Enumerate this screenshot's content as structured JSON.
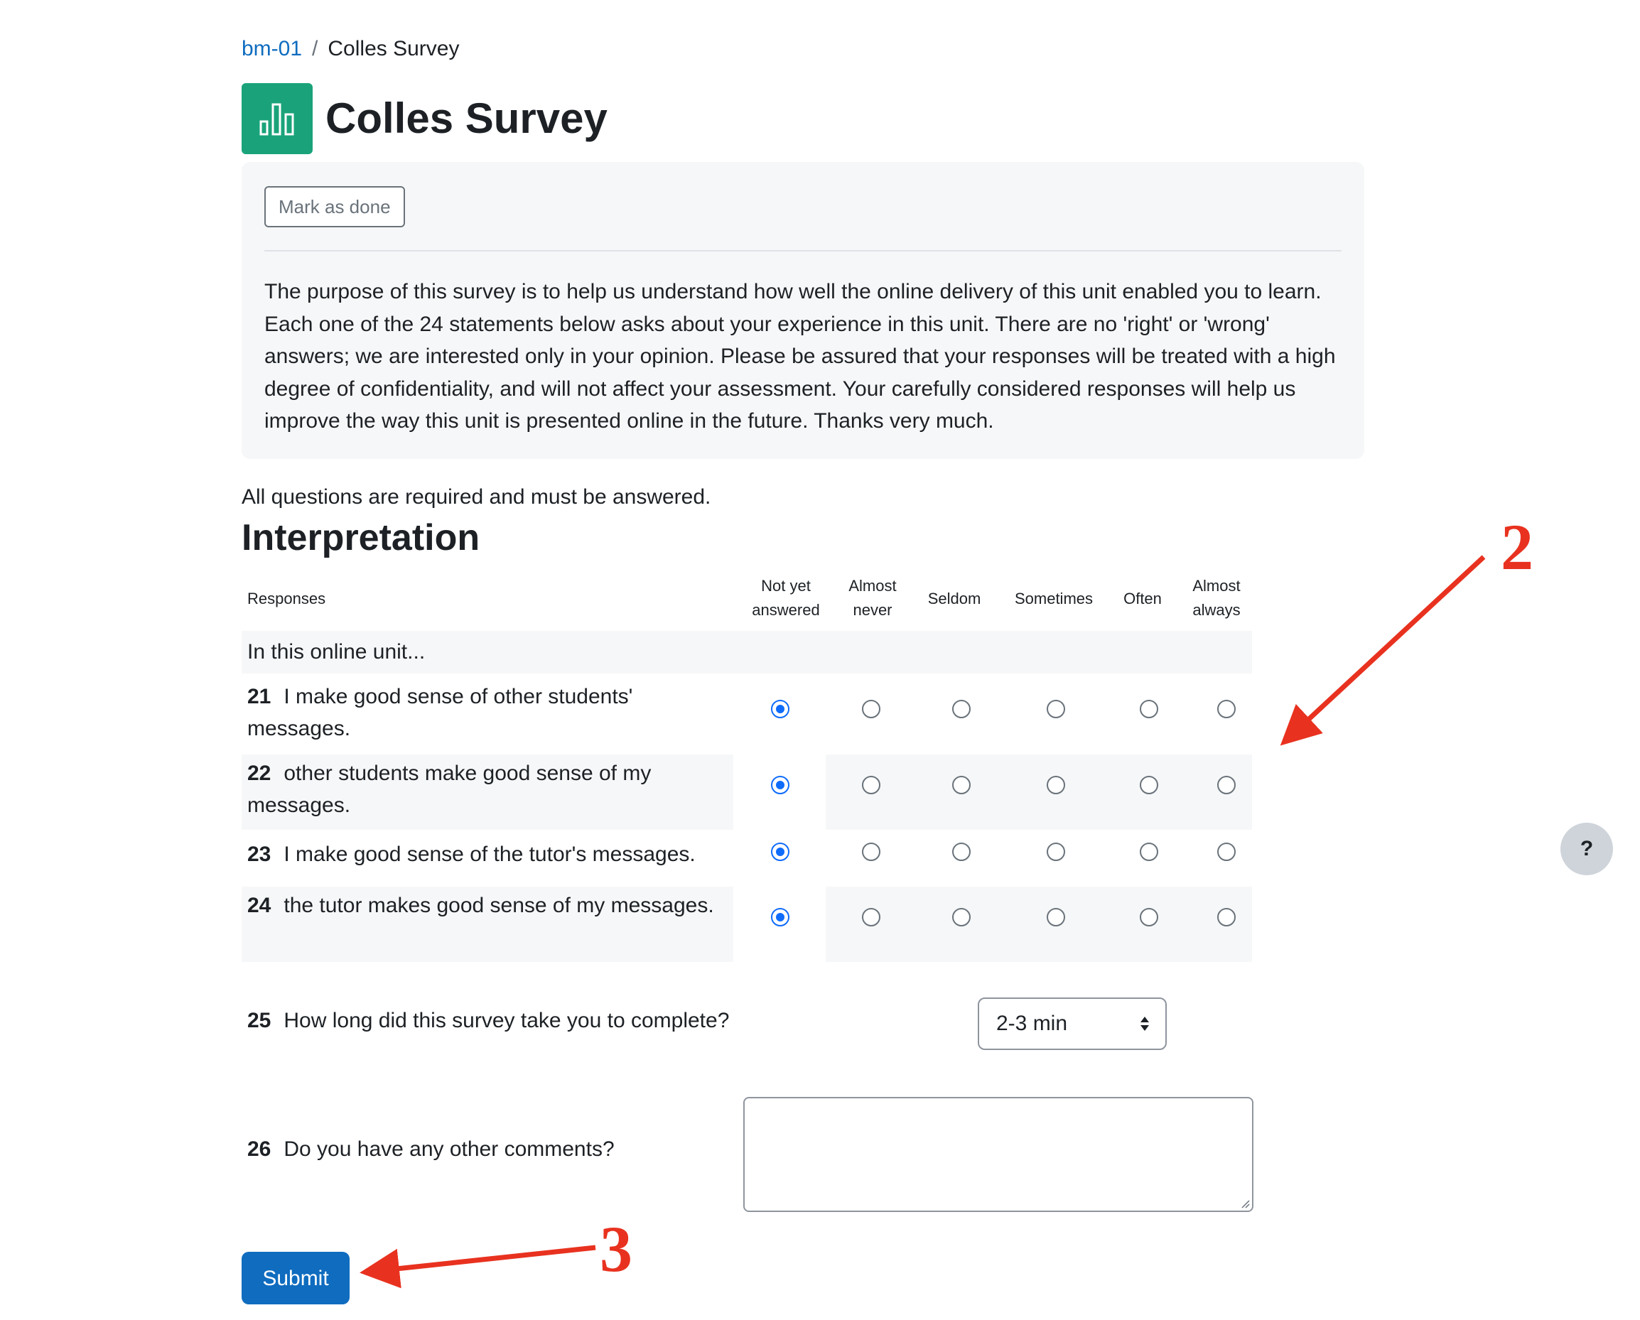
{
  "breadcrumb": {
    "course": "bm-01",
    "separator": "/",
    "current": "Colles Survey"
  },
  "page": {
    "title": "Colles Survey",
    "icon": "bar-chart-icon"
  },
  "completion": {
    "mark_done_label": "Mark as done"
  },
  "intro": {
    "text": "The purpose of this survey is to help us understand how well the online delivery of this unit enabled you to learn. Each one of the 24 statements below asks about your experience in this unit. There are no 'right' or 'wrong' answers; we are interested only in your opinion. Please be assured that your responses will be treated with a high degree of confidentiality, and will not affect your assessment. Your carefully considered responses will help us improve the way this unit is presented online in the future. Thanks very much."
  },
  "required_note": "All questions are required and must be answered.",
  "section": {
    "heading": "Interpretation",
    "responses_label": "Responses",
    "columns": [
      {
        "line1": "Not yet",
        "line2": "answered"
      },
      {
        "line1": "Almost",
        "line2": "never"
      },
      {
        "line1": "Seldom",
        "line2": ""
      },
      {
        "line1": "Sometimes",
        "line2": ""
      },
      {
        "line1": "Often",
        "line2": ""
      },
      {
        "line1": "Almost",
        "line2": "always"
      }
    ],
    "group_label": "In this online unit...",
    "questions": [
      {
        "number": "21",
        "text": "I make good sense of other students' messages.",
        "selected_column": "Not yet answered"
      },
      {
        "number": "22",
        "text": "other students make good sense of my messages.",
        "selected_column": "Not yet answered"
      },
      {
        "number": "23",
        "text": "I make good sense of the tutor's messages.",
        "selected_column": "Not yet answered"
      },
      {
        "number": "24",
        "text": "the tutor makes good sense of my messages.",
        "selected_column": "Not yet answered"
      }
    ]
  },
  "duration_question": {
    "number": "25",
    "text": "How long did this survey take you to complete?",
    "selected": "2-3 min"
  },
  "comments_question": {
    "number": "26",
    "text": "Do you have any other comments?",
    "value": ""
  },
  "submit_label": "Submit",
  "help_label": "?",
  "annotations": {
    "arrow_2_label": "2",
    "arrow_3_label": "3",
    "arrow_color": "#e8321f"
  },
  "colors": {
    "brand": "#0f6cbf",
    "activity_icon": "#1aa37a",
    "radio_checked": "#0f6cfb"
  }
}
